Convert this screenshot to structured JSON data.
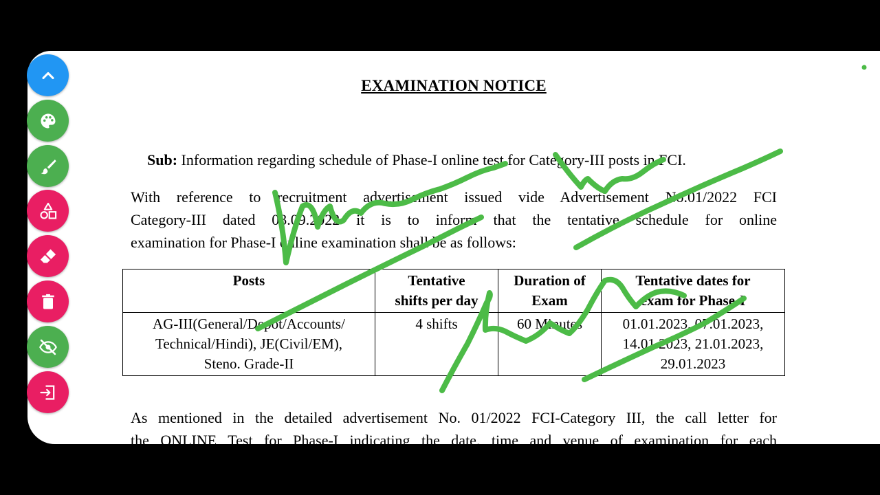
{
  "notice": {
    "title": "EXAMINATION NOTICE",
    "sub_label": "Sub:",
    "sub_text": " Information regarding schedule of Phase-I online test for Category-III posts in FCI.",
    "para1_lines": [
      "With reference to recruitment advertisement issued vide Advertisement No.01/2022 FCI",
      "Category-III dated 03.09.2022 it is to inform that the tentative schedule for online",
      "examination for Phase-I online examination shall be as follows:"
    ],
    "para2_lines": [
      "As mentioned in the detailed advertisement No. 01/2022 FCI-Category III, the call letter for",
      "the ONLINE Test for Phase-I indicating the date, time and venue of examination for each"
    ]
  },
  "table": {
    "headers": [
      [
        "Posts"
      ],
      [
        "Tentative",
        "shifts per day"
      ],
      [
        "Duration of",
        "Exam"
      ],
      [
        "Tentative dates for",
        "exam for Phase-I"
      ]
    ],
    "row": {
      "posts": [
        "AG-III(General/Depot/Accounts/",
        "Technical/Hindi), JE(Civil/EM),",
        "Steno. Grade-II"
      ],
      "shifts": "4 shifts",
      "duration": "60 Minutes",
      "dates": [
        "01.01.2023, 07.01.2023,",
        "14.01.2023, 21.01.2023,",
        "29.01.2023"
      ]
    }
  },
  "toolbar": {
    "tools": [
      {
        "name": "collapse-toolbar-button",
        "icon": "chevron-up-icon",
        "color": "#2196F3"
      },
      {
        "name": "color-palette-button",
        "icon": "palette-icon",
        "color": "#4CAF50"
      },
      {
        "name": "brush-button",
        "icon": "brush-icon",
        "color": "#4CAF50"
      },
      {
        "name": "shapes-button",
        "icon": "shapes-icon",
        "color": "#E91E63"
      },
      {
        "name": "eraser-button",
        "icon": "eraser-icon",
        "color": "#E91E63"
      },
      {
        "name": "delete-button",
        "icon": "trash-icon",
        "color": "#E91E63"
      },
      {
        "name": "hide-drawing-button",
        "icon": "eye-off-icon",
        "color": "#4CAF50"
      },
      {
        "name": "exit-button",
        "icon": "exit-icon",
        "color": "#E91E63"
      }
    ]
  },
  "colors": {
    "ink_stroke": "#4CBB47",
    "background": "#000000",
    "page": "#FFFFFF"
  }
}
